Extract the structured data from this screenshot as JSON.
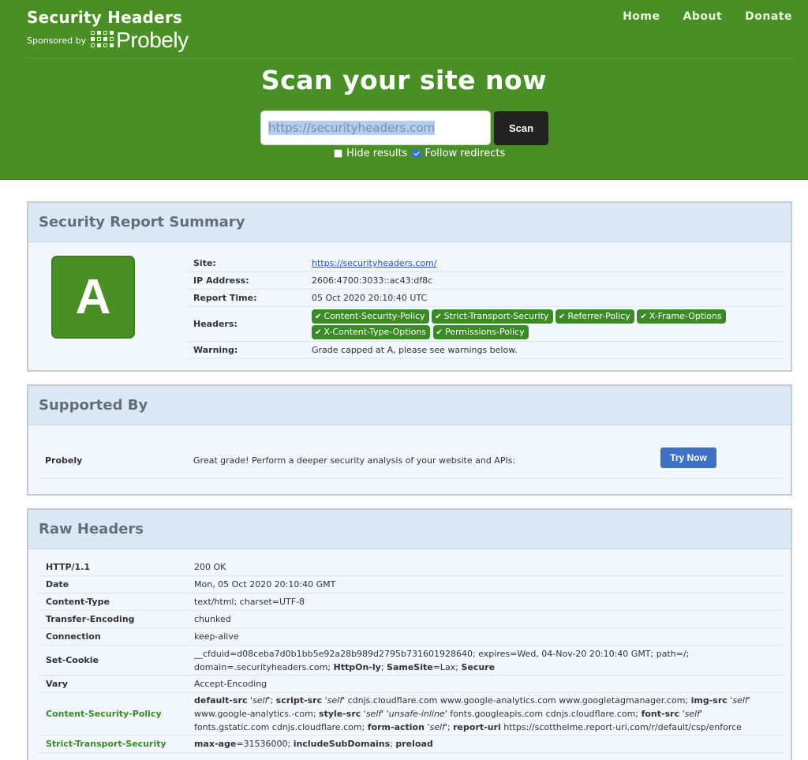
{
  "header": {
    "brand_title": "Security Headers",
    "sponsored_by": "Sponsored by",
    "sponsor_name": "Probely",
    "nav": [
      "Home",
      "About",
      "Donate"
    ],
    "scan_title": "Scan your site now",
    "scan_input_value": "https://securityheaders.com",
    "scan_button": "Scan",
    "hide_results_label": "Hide results",
    "hide_results_checked": false,
    "follow_redirects_label": "Follow redirects",
    "follow_redirects_checked": true
  },
  "summary": {
    "title": "Security Report Summary",
    "grade": "A",
    "grade_color": "#4a8f26",
    "rows": {
      "site_label": "Site:",
      "site_value": "https://securityheaders.com/",
      "ip_label": "IP Address:",
      "ip_value": "2606:4700:3033::ac43:df8c",
      "time_label": "Report Time:",
      "time_value": "05 Oct 2020 20:10:40 UTC",
      "headers_label": "Headers:",
      "warning_label": "Warning:",
      "warning_value": "Grade capped at A, please see warnings below."
    },
    "header_pills": [
      "Content-Security-Policy",
      "Strict-Transport-Security",
      "Referrer-Policy",
      "X-Frame-Options",
      "X-Content-Type-Options",
      "Permissions-Policy"
    ]
  },
  "supported": {
    "title": "Supported By",
    "name": "Probely",
    "text": "Great grade! Perform a deeper security analysis of your website and APIs:",
    "button": "Try Now"
  },
  "raw": {
    "title": "Raw Headers",
    "rows": [
      {
        "key": "HTTP/1.1",
        "value": "200 OK"
      },
      {
        "key": "Date",
        "value": "Mon, 05 Oct 2020 20:10:40 GMT"
      },
      {
        "key": "Content-Type",
        "value": "text/html; charset=UTF-8"
      },
      {
        "key": "Transfer-Encoding",
        "value": "chunked"
      },
      {
        "key": "Connection",
        "value": "keep-alive"
      },
      {
        "key": "Set-Cookie",
        "value_parts": [
          "__cfduid=d08ceba7d0b1bb5e92a28b989d2795b731601928640; expires=Wed, 04-Nov-20 20:10:40 GMT; path=/; domain=.securityheaders.com; ",
          "HttpOn-ly",
          "; ",
          "SameSite",
          "=Lax; ",
          "Secure"
        ]
      },
      {
        "key": "Vary",
        "value": "Accept-Encoding"
      },
      {
        "key": "Content-Security-Policy",
        "value_parts": [
          "default-src",
          "'self'",
          "script-src",
          "'self'",
          "cdnjs.cloudflare.com www.google-analytics.com www.googletagmanager.com;",
          "img-src",
          "'self'",
          "www.google-analytics.-com;",
          "style-src",
          "'self' 'unsafe-inline'",
          "fonts.googleapis.com cdnjs.cloudflare.com;",
          "font-src",
          "'self'",
          "fonts.gstatic.com cdnjs.cloudflare.com;",
          "form-action",
          "'self'",
          "report-uri",
          "https://scotthelme.report-uri.com/r/default/csp/enforce"
        ]
      },
      {
        "key": "Strict-Transport-Security",
        "value_parts": [
          "max-age",
          "=31536000; ",
          "includeSubDomains",
          "; ",
          "preload"
        ]
      }
    ]
  }
}
